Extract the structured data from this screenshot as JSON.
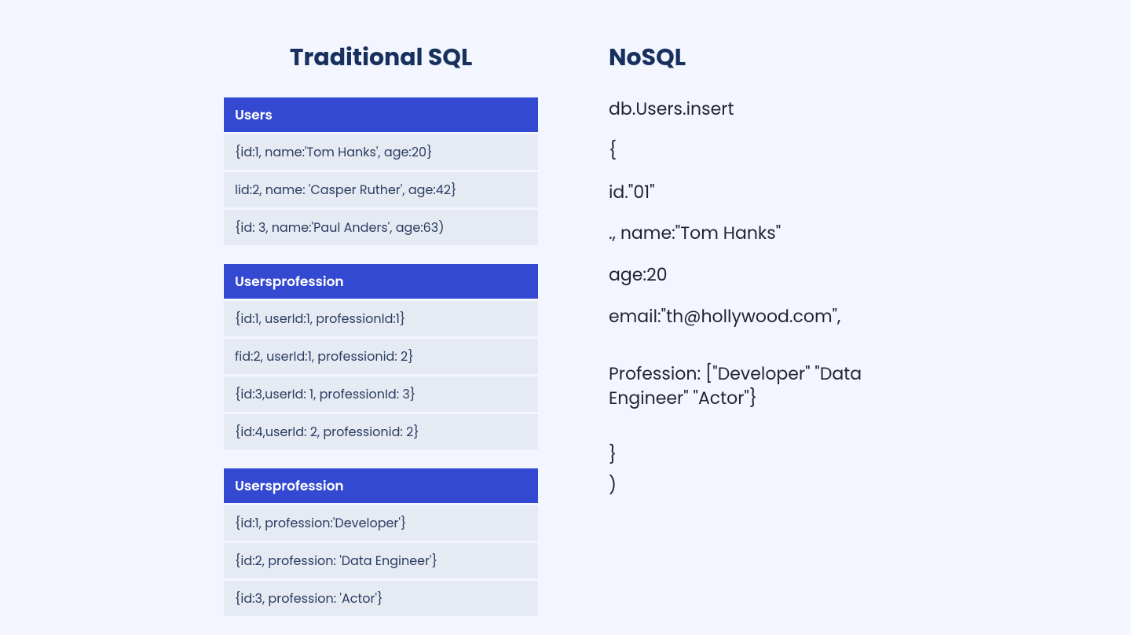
{
  "sql": {
    "title": "Traditional SQL",
    "tables": [
      {
        "header": "Users",
        "rows": [
          "{id:1, name:'Tom Hanks', age:20}",
          "lid:2, name: 'Casper Ruther', age:42}",
          "{id: 3, name:'Paul Anders', age:63)"
        ]
      },
      {
        "header": "Usersprofession",
        "rows": [
          "{id:1, userId:1, professionId:1}",
          "fid:2, userId:1, professionid: 2}",
          "{id:3,userId: 1, professionId: 3}",
          "{id:4,userId: 2, professionid: 2}"
        ]
      },
      {
        "header": "Usersprofession",
        "rows": [
          "{id:1, profession:'Developer'}",
          "{id:2, profession: 'Data Engineer'}",
          "{id:3, profession: 'Actor'}"
        ]
      }
    ]
  },
  "nosql": {
    "title": "NoSQL",
    "lines": [
      "db.Users.insert",
      "{",
      "id.\"01\"",
      "., name:\"Tom Hanks\"",
      "age:20",
      "email:\"th@hollywood.com\",",
      "",
      "Profession: [\"Developer\" \"Data Engineer\" \"Actor\"}",
      "",
      "}",
      ")"
    ]
  }
}
